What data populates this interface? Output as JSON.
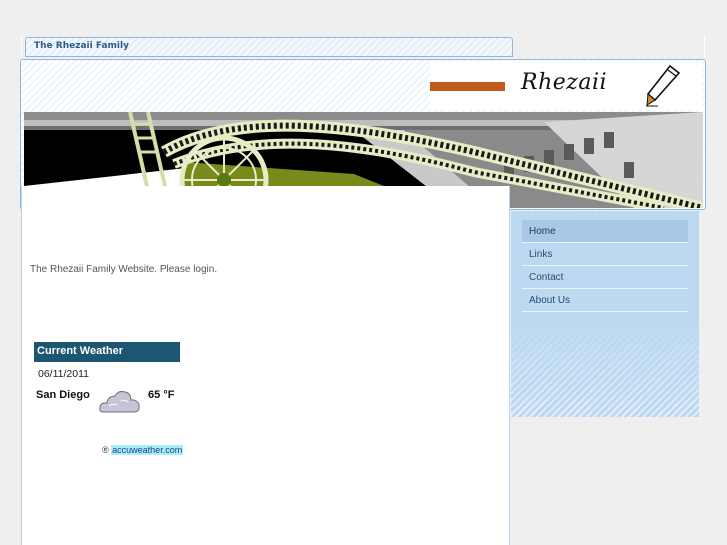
{
  "site": {
    "tab_title": "The Rhezaii Family",
    "logo_text": "Rhezaii"
  },
  "main": {
    "welcome_text": "The Rhezaii Family Website. Please login."
  },
  "weather": {
    "heading": "Current Weather",
    "date": "06/11/2011",
    "city": "San Diego",
    "temperature": "65 °F",
    "condition_icon": "cloud-icon",
    "credit_symbol": "®",
    "credit_link": "accuweather.com"
  },
  "nav": {
    "items": [
      {
        "label": "Home"
      },
      {
        "label": "Links"
      },
      {
        "label": "Contact"
      },
      {
        "label": "About Us"
      }
    ]
  },
  "colors": {
    "accent_orange": "#c05a1a",
    "weather_header": "#1d5672",
    "sidebar_blue": "#bcd9f1",
    "link_highlight": "#a8f0f8"
  }
}
